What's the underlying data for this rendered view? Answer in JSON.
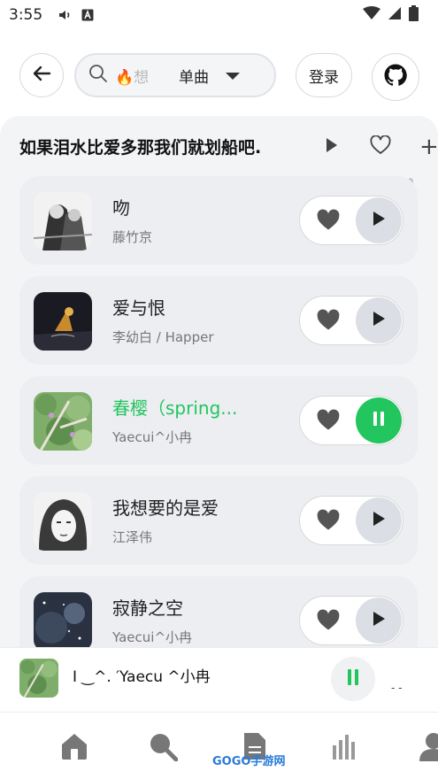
{
  "status_bar": {
    "time": "3:55"
  },
  "header": {
    "search_placeholder": "🔥想",
    "search_mode": "单曲",
    "login_label": "登录"
  },
  "playlist": {
    "title": "如果泪水比爱多那我们就划船吧.",
    "add_label": "+"
  },
  "songs": [
    {
      "title": "吻",
      "artist": "藤竹京",
      "playing": false
    },
    {
      "title": "爱与恨",
      "artist": "李幼白 / Happer",
      "playing": false
    },
    {
      "title": "春樱（spring...",
      "artist": "Yaecui^小冉",
      "playing": true
    },
    {
      "title": "我想要的是爱",
      "artist": "江泽伟",
      "playing": false
    },
    {
      "title": "寂静之空",
      "artist": "Yaecui^小冉",
      "playing": false
    }
  ],
  "now_playing": {
    "text": "I     ‿^.   ′Yaecu ^小冉",
    "more": "- -"
  },
  "bottom_nav": {
    "watermark": "GOGO手游网",
    "items": [
      "home-icon",
      "search-icon",
      "document-icon",
      "chart-icon",
      "user-icon"
    ]
  },
  "colors": {
    "accent": "#22c55e",
    "panel": "#f3f4f6"
  }
}
